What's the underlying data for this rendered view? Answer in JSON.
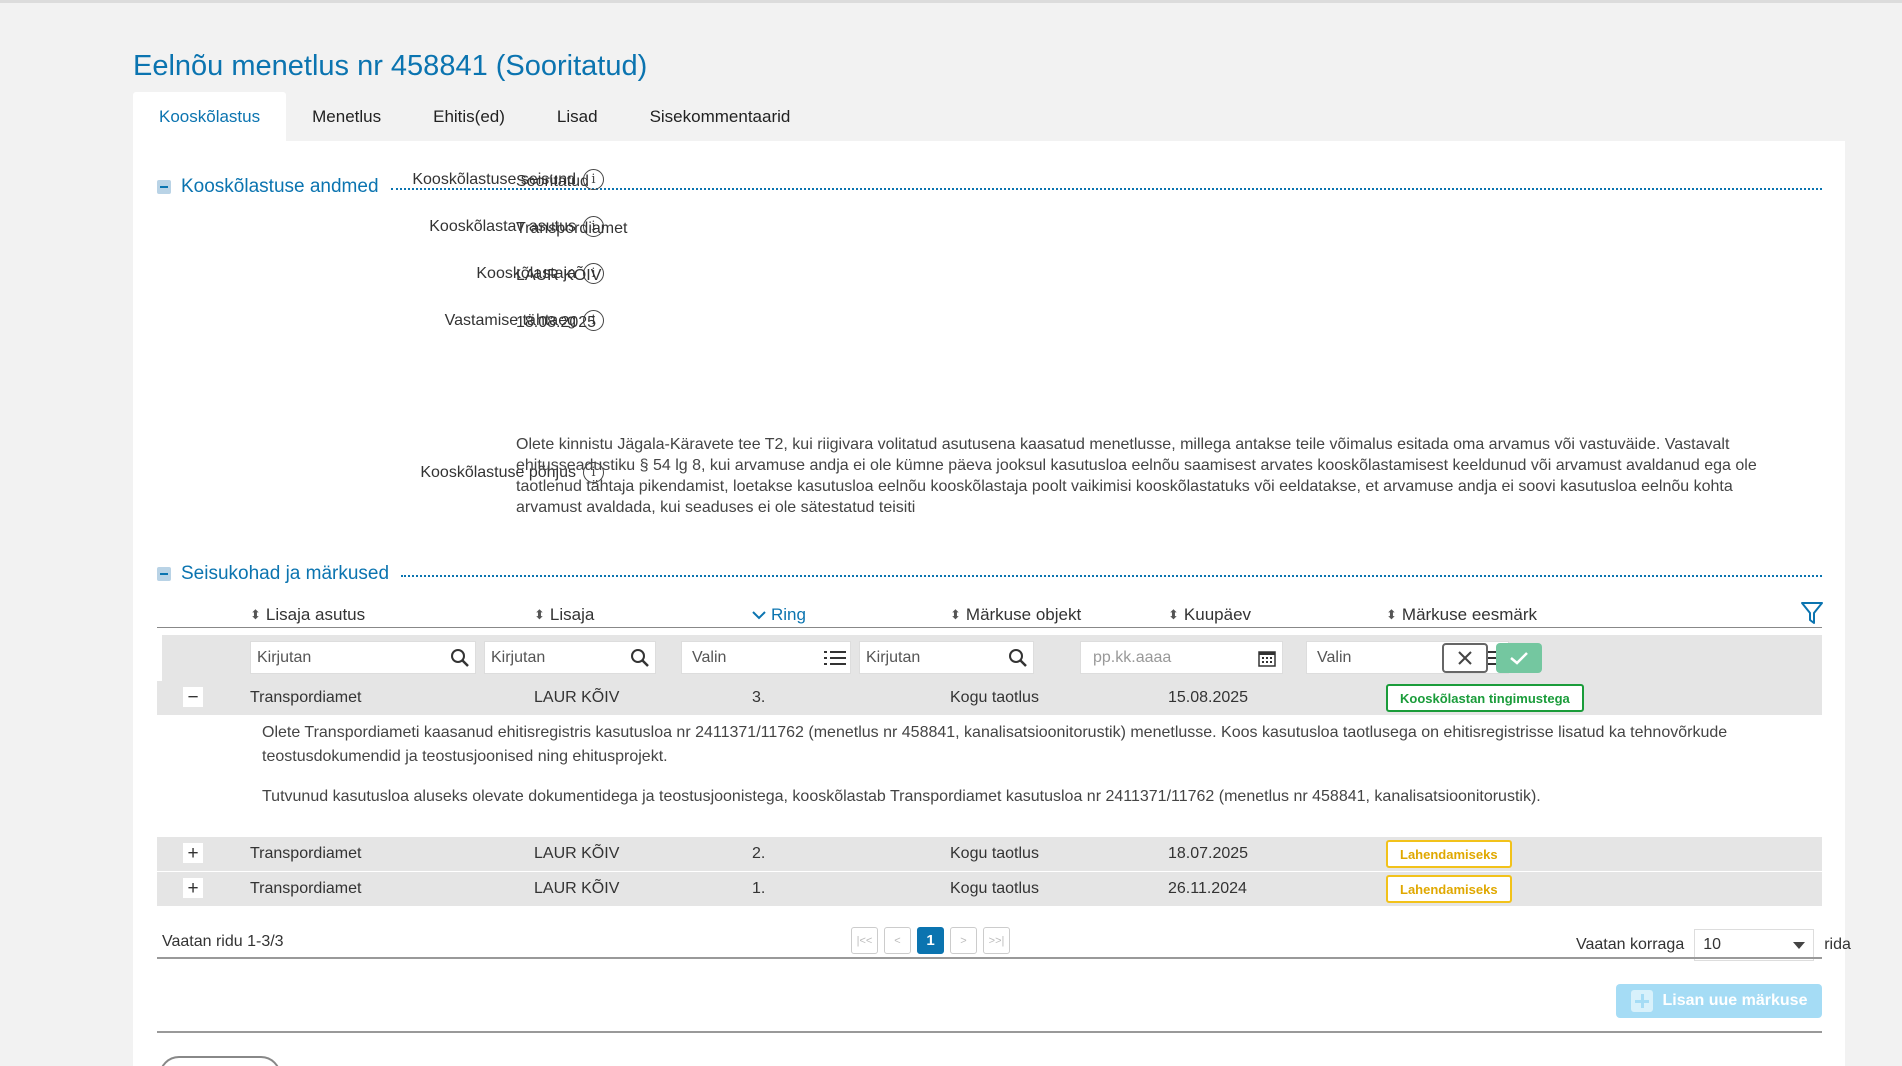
{
  "page": {
    "title": "Eelnõu menetlus nr 458841 (Sooritatud)"
  },
  "tabs": [
    {
      "label": "Kooskõlastus"
    },
    {
      "label": "Menetlus"
    },
    {
      "label": "Ehitis(ed)"
    },
    {
      "label": "Lisad"
    },
    {
      "label": "Sisekommentaarid"
    }
  ],
  "coordination": {
    "section_title": "Kooskõlastuse andmed",
    "fields": [
      {
        "label": "Kooskõlastuse seisund",
        "value": "Sooritatud"
      },
      {
        "label": "Kooskõlastav asutus",
        "value": "Transpordiamet"
      },
      {
        "label": "Kooskõlastaja",
        "value": "LAUR KÕIV"
      },
      {
        "label": "Vastamise tähtaeg",
        "value": "18.08.2025"
      }
    ],
    "reason_label": "Kooskõlastuse põhjus",
    "reason_text": "Olete kinnistu Jägala-Käravete tee T2, kui riigivara volitatud asutusena kaasatud menetlusse, millega antakse teile võimalus esitada oma arvamus või vastuväide. Vastavalt ehitusseadustiku § 54 lg 8, kui arvamuse andja ei ole kümne päeva jooksul kasutusloa eelnõu saamisest arvates kooskõlastamisest keeldunud või arvamust avaldanud ega ole taotlenud tähtaja pikendamist, loetakse kasutusloa eelnõu kooskõlastaja poolt vaikimisi kooskõlastatuks või eeldatakse, et arvamuse andja ei soovi kasutusloa eelnõu kohta arvamust avaldada, kui seaduses ei ole sätestatud teisiti",
    "info_glyph": "i"
  },
  "remarks": {
    "section_title": "Seisukohad ja märkused",
    "columns": [
      {
        "label": "Lisaja asutus"
      },
      {
        "label": "Lisaja"
      },
      {
        "label": "Ring"
      },
      {
        "label": "Märkuse objekt"
      },
      {
        "label": "Kuupäev"
      },
      {
        "label": "Märkuse eesmärk"
      }
    ],
    "filters": {
      "agency_placeholder": "Kirjutan",
      "adder_placeholder": "Kirjutan",
      "round_placeholder": "Valin",
      "object_placeholder": "Kirjutan",
      "date_placeholder": "pp.kk.aaaa",
      "purpose_placeholder": "Valin"
    },
    "rows": [
      {
        "toggle": "−",
        "agency": "Transpordiamet",
        "adder": "LAUR KÕIV",
        "round": "3.",
        "object": "Kogu taotlus",
        "date": "15.08.2025",
        "purpose": "Kooskõlastan tingimustega"
      },
      {
        "toggle": "+",
        "agency": "Transpordiamet",
        "adder": "LAUR KÕIV",
        "round": "2.",
        "object": "Kogu taotlus",
        "date": "18.07.2025",
        "purpose": "Lahendamiseks"
      },
      {
        "toggle": "+",
        "agency": "Transpordiamet",
        "adder": "LAUR KÕIV",
        "round": "1.",
        "object": "Kogu taotlus",
        "date": "26.11.2024",
        "purpose": "Lahendamiseks"
      }
    ],
    "detail_paragraphs": [
      "Olete Transpordiameti kaasanud ehitisregistris kasutusloa nr 2411371/11762 (menetlus nr 458841, kanalisatsioonitorustik) menetlusse. Koos kasutusloa taotlusega on ehitisregistrisse lisatud ka tehnovõrkude teostusdokumendid ja teostusjoonised ning ehitusprojekt.",
      "Tutvunud kasutusloa aluseks olevate dokumentidega ja teostusjoonistega, kooskõlastab Transpordiamet kasutusloa nr 2411371/11762 (menetlus nr 458841, kanalisatsioonitorustik)."
    ],
    "pagination": {
      "summary": "Vaatan ridu 1-3/3",
      "first": "|<<",
      "prev": "<",
      "current": "1",
      "next": ">",
      "last": ">>|",
      "page_size_label": "Vaatan korraga",
      "page_size": "10",
      "page_size_suffix": "rida"
    },
    "add_button": "Lisan uue märkuse"
  },
  "colors": {
    "accent": "#0b74b0",
    "badge_green": "#1a9c3a",
    "badge_yellow": "#e0a800",
    "confirm": "#74c7a0",
    "add_button": "#a5dcf5"
  }
}
